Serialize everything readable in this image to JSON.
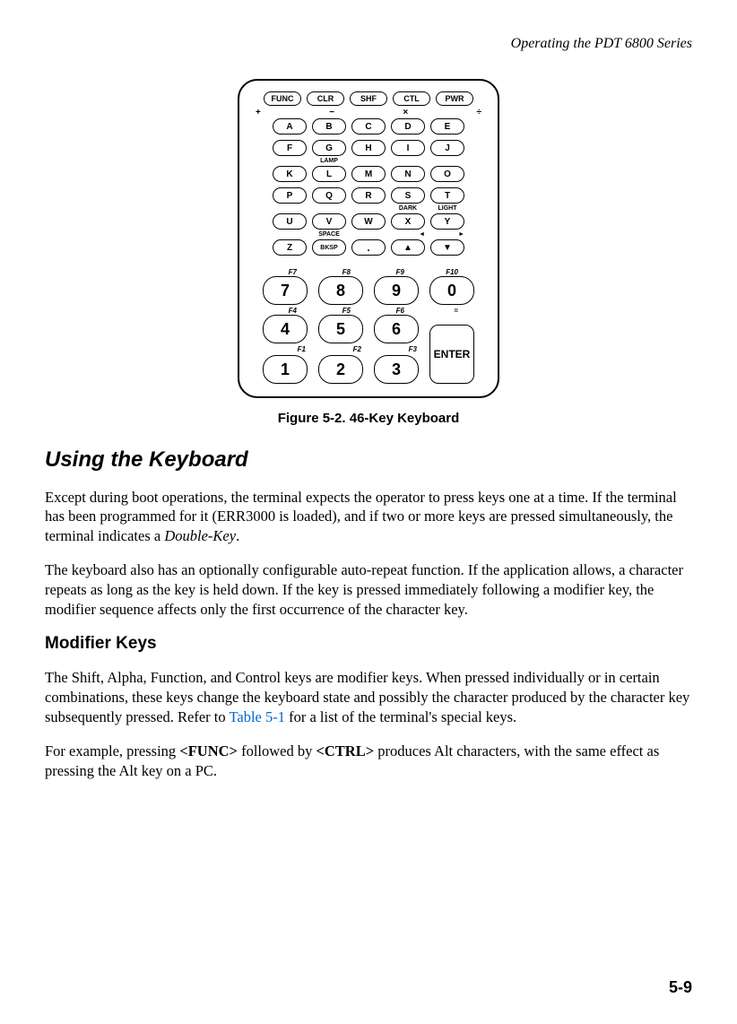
{
  "header": {
    "running": "Operating the PDT 6800 Series"
  },
  "figure": {
    "caption": "Figure 5-2.  46-Key Keyboard",
    "top_row": [
      "FUNC",
      "CLR",
      "SHF",
      "CTL",
      "PWR"
    ],
    "sym_row": [
      "+",
      "−",
      "×",
      "÷"
    ],
    "letters": [
      [
        "A",
        "B",
        "C",
        "D",
        "E"
      ],
      [
        "F",
        "G",
        "H",
        "I",
        "J"
      ],
      [
        "K",
        "L",
        "M",
        "N",
        "O"
      ],
      [
        "P",
        "Q",
        "R",
        "S",
        "T"
      ],
      [
        "U",
        "V",
        "W",
        "X",
        "Y"
      ]
    ],
    "row6": [
      "Z",
      "BKSP",
      ".",
      "▲",
      "▼"
    ],
    "label_lamp": "LAMP",
    "label_dark": "DARK",
    "label_light": "LIGHT",
    "label_space": "SPACE",
    "flabels": {
      "r1": [
        "F7",
        "F8",
        "F9",
        "F10"
      ],
      "r2": [
        "F4",
        "F5",
        "F6",
        "="
      ],
      "r3": [
        "F1",
        "F2",
        "F3"
      ]
    },
    "numbers": {
      "r1": [
        "7",
        "8",
        "9",
        "0"
      ],
      "r2": [
        "4",
        "5",
        "6"
      ],
      "r3": [
        "1",
        "2",
        "3"
      ]
    },
    "enter": "ENTER"
  },
  "sections": {
    "using_kb_title": "Using the Keyboard",
    "using_kb_p1a": "Except during boot operations, the terminal expects the operator to press keys one at a time. If the terminal has been programmed for it (ERR3000 is loaded), and if two or more keys are pressed simultaneously, the terminal indicates a ",
    "using_kb_p1_em": "Double-Key",
    "using_kb_p1b": ".",
    "using_kb_p2": "The keyboard also has an optionally configurable auto-repeat function. If the application allows, a character repeats as long as the key is held down. If the key is pressed immediately following a modifier key, the modifier sequence affects only the first occurrence of the character key.",
    "mod_title": "Modifier Keys",
    "mod_p1a": "The Shift, Alpha, Function, and Control keys are modifier keys. When pressed individually or in certain combinations, these keys change the keyboard state and possibly the character produced by the character key subsequently pressed. Refer to ",
    "mod_p1_link": "Table 5-1",
    "mod_p1b": " for a list of the terminal's special keys.",
    "mod_p2a": "For example, pressing ",
    "mod_p2_k1": "<FUNC>",
    "mod_p2b": " followed by ",
    "mod_p2_k2": "<CTRL>",
    "mod_p2c": " produces Alt characters, with the same effect as pressing the Alt key on a PC."
  },
  "pagenum": "5-9"
}
